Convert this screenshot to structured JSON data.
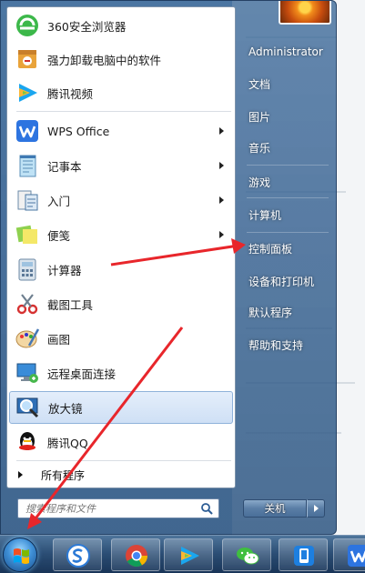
{
  "left_menu": {
    "items": [
      {
        "label": "360安全浏览器",
        "has_arrow": false,
        "icon": "360-browser-icon"
      },
      {
        "label": "强力卸载电脑中的软件",
        "has_arrow": false,
        "icon": "uninstaller-icon"
      },
      {
        "label": "腾讯视频",
        "has_arrow": false,
        "icon": "tencent-video-icon"
      },
      {
        "label": "WPS Office",
        "has_arrow": true,
        "icon": "wps-office-icon"
      },
      {
        "label": "记事本",
        "has_arrow": true,
        "icon": "notepad-icon"
      },
      {
        "label": "入门",
        "has_arrow": true,
        "icon": "getting-started-icon"
      },
      {
        "label": "便笺",
        "has_arrow": true,
        "icon": "sticky-notes-icon"
      },
      {
        "label": "计算器",
        "has_arrow": false,
        "icon": "calculator-icon"
      },
      {
        "label": "截图工具",
        "has_arrow": false,
        "icon": "snipping-tool-icon"
      },
      {
        "label": "画图",
        "has_arrow": false,
        "icon": "paint-icon"
      },
      {
        "label": "远程桌面连接",
        "has_arrow": false,
        "icon": "remote-desktop-icon"
      },
      {
        "label": "放大镜",
        "has_arrow": false,
        "icon": "magnifier-icon"
      },
      {
        "label": "腾讯QQ",
        "has_arrow": false,
        "icon": "qq-icon"
      }
    ],
    "all_programs": "所有程序"
  },
  "search": {
    "placeholder": "搜索程序和文件"
  },
  "right_menu": {
    "user": "Administrator",
    "items": [
      "文档",
      "图片",
      "音乐",
      "游戏",
      "计算机",
      "控制面板",
      "设备和打印机",
      "默认程序",
      "帮助和支持"
    ]
  },
  "shutdown": {
    "label": "关机"
  },
  "taskbar": {
    "buttons": [
      "sogou-input-icon",
      "chrome-icon",
      "tencent-video-icon",
      "wechat-icon",
      "phone-manager-icon",
      "wps-icon"
    ]
  },
  "colors": {
    "annotation_red": "#e8262b",
    "highlight_blue": "#cfe0f5"
  }
}
